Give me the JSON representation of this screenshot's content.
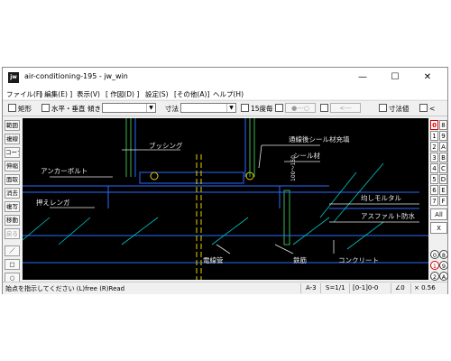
{
  "window": {
    "app_icon": "jw",
    "title": "air-conditioning-195 - jw_win",
    "min_label": "—",
    "max_label": "☐",
    "close_label": "✕"
  },
  "menu": [
    "ファイル(F)",
    "[ 編集(E) ]",
    "表示(V)",
    "[ 作図(D) ]",
    "設定(S)",
    "[その他(A)]",
    "ヘルプ(H)"
  ],
  "toolbar": {
    "rect_label": "矩形",
    "hv_label": "水平・垂直",
    "tilt_label": "傾き",
    "tilt_value": "",
    "dim_label": "寸法",
    "dim_value": "",
    "deg15_label": "15度毎",
    "btn1": "●---○",
    "btn2": "<---",
    "dimval_label": "寸法値",
    "lt_label": "<"
  },
  "left_tools": [
    "範囲",
    "複線",
    "コーナー",
    "伸縮",
    "面取",
    "消去",
    "複写",
    "移動",
    "戻る",
    "／",
    "□",
    "○"
  ],
  "right_panel": {
    "layer_buttons": [
      "0",
      "8",
      "1",
      "9",
      "2",
      "A",
      "3",
      "B",
      "4",
      "C",
      "5",
      "D",
      "6",
      "E",
      "7",
      "F"
    ],
    "all_label": "All",
    "x_label": "X",
    "circles": [
      "0",
      "8",
      "1",
      "9",
      "2",
      "A"
    ]
  },
  "drawing": {
    "labels": {
      "bushing": "ブッシング",
      "sealant": "通線後シール材充填",
      "seal": "シール材",
      "anchor": "アンカーボルト",
      "mortar": "均しモルタル",
      "asphalt": "アスファルト防水",
      "brick": "押えレンガ",
      "rebar": "鉄筋",
      "conduit": "電線管",
      "concrete": "コンクリート",
      "dim": "100～150"
    },
    "colors": {
      "line": "#2a6cff",
      "edge": "#3cb44b",
      "text": "#e8e8e8",
      "hatch": "#00c8c8",
      "yellow": "#e6d200"
    }
  },
  "status": {
    "message": "始点を指示してください (L)free (R)Read",
    "paper": "A-3",
    "scale": "S=1/1",
    "layer": "[0-1]0-0",
    "angle": "∠0",
    "ratio": "× 0.56"
  }
}
